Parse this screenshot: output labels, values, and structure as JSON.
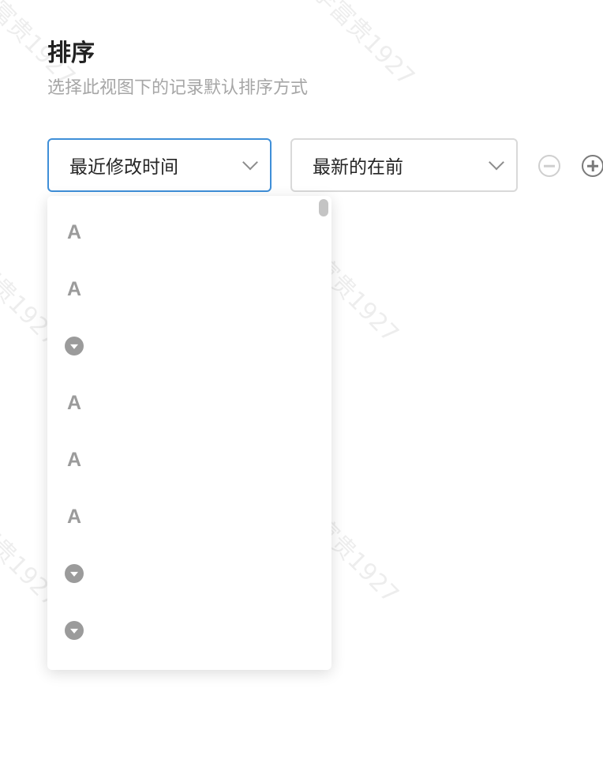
{
  "header": {
    "title": "排序",
    "subtitle": "选择此视图下的记录默认排序方式"
  },
  "sort": {
    "field_value": "最近修改时间",
    "order_value": "最新的在前"
  },
  "dropdown": {
    "options": [
      {
        "icon": "text-field-icon",
        "glyph": "A"
      },
      {
        "icon": "text-field-icon",
        "glyph": "A"
      },
      {
        "icon": "single-select-icon",
        "glyph": ""
      },
      {
        "icon": "text-field-icon",
        "glyph": "A"
      },
      {
        "icon": "text-field-icon",
        "glyph": "A"
      },
      {
        "icon": "text-field-icon",
        "glyph": "A"
      },
      {
        "icon": "single-select-icon",
        "glyph": ""
      },
      {
        "icon": "single-select-icon",
        "glyph": ""
      }
    ]
  },
  "watermark": "李富贵1927",
  "colors": {
    "accent_border": "#3f8fd8",
    "icon_gray": "#9b9b9b",
    "subtitle": "#a6a6a6"
  }
}
